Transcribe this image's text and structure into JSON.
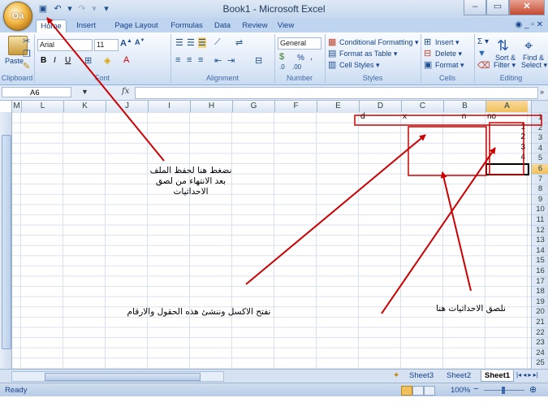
{
  "window": {
    "title": "Book1 - Microsoft Excel",
    "office_button_label": "Oa",
    "controls": {
      "minimize": "–",
      "maximize": "▭",
      "close": "✕"
    },
    "ribbon_controls": "◉ _ ▫ ✕"
  },
  "qat": {
    "save": "▣",
    "undo": "↶",
    "undo_arrow": "▾",
    "redo": "↷",
    "redo_arrow": "▾",
    "customize": "▾"
  },
  "tabs": [
    "Home",
    "Insert",
    "Page Layout",
    "Formulas",
    "Data",
    "Review",
    "View"
  ],
  "ribbon": {
    "clipboard": {
      "label": "Clipboard",
      "paste": "Paste"
    },
    "font": {
      "label": "Font",
      "name": "Arial",
      "size": "11",
      "bold": "B",
      "italic": "I",
      "underline": "U"
    },
    "alignment": {
      "label": "Alignment"
    },
    "number": {
      "label": "Number",
      "format": "General",
      "percent": "%"
    },
    "styles": {
      "label": "Styles",
      "conditional": "Conditional Formatting ▾",
      "table": "Format as Table ▾",
      "cell_styles": "Cell Styles ▾"
    },
    "cells": {
      "label": "Cells",
      "insert": "Insert ▾",
      "delete": "Delete ▾",
      "format": "Format ▾"
    },
    "editing": {
      "label": "Editing",
      "sigma": "Σ ▾",
      "sort": "Sort &",
      "filter": "Filter ▾",
      "find": "Find &",
      "select": "Select ▾"
    }
  },
  "formula_bar": {
    "name_box": "A6",
    "fx": "fx",
    "value": ""
  },
  "columns": [
    "M",
    "L",
    "K",
    "J",
    "I",
    "H",
    "G",
    "F",
    "E",
    "D",
    "C",
    "B",
    "A"
  ],
  "selected_column": "A",
  "rows": [
    "1",
    "2",
    "3",
    "4",
    "5",
    "6",
    "7",
    "8",
    "9",
    "10",
    "11",
    "12",
    "13",
    "14",
    "15",
    "16",
    "17",
    "18",
    "19",
    "20",
    "21",
    "22",
    "23",
    "24",
    "25"
  ],
  "selected_row": "6",
  "cells": {
    "header_row": {
      "A": "no",
      "B": "n",
      "C": "x",
      "D": "d"
    },
    "A2": "1",
    "A3": "2",
    "A4": "3",
    "A5": "4"
  },
  "sheets": [
    "Sheet3",
    "Sheet2",
    "Sheet1"
  ],
  "active_sheet": "Sheet1",
  "sheet_nav": "|◂ ◂ ▸ ▸|",
  "status": {
    "ready": "Ready",
    "zoom": "100%",
    "zoom_minus": "−",
    "zoom_plus": "⊕"
  },
  "annotations": {
    "save_note": [
      "نضغط هنا لحفظ الملف",
      "بعد الانتهاء من لصق",
      "الاحداثيات"
    ],
    "create_note": "نفتح الاكسل وننشئ هذه الحقول والارقام",
    "paste_note": "نلصق الاحداثيات هنا"
  },
  "colors": {
    "annotation": "#cc0000",
    "selection": "#f1c05a",
    "ribbon_text": "#15428b"
  }
}
